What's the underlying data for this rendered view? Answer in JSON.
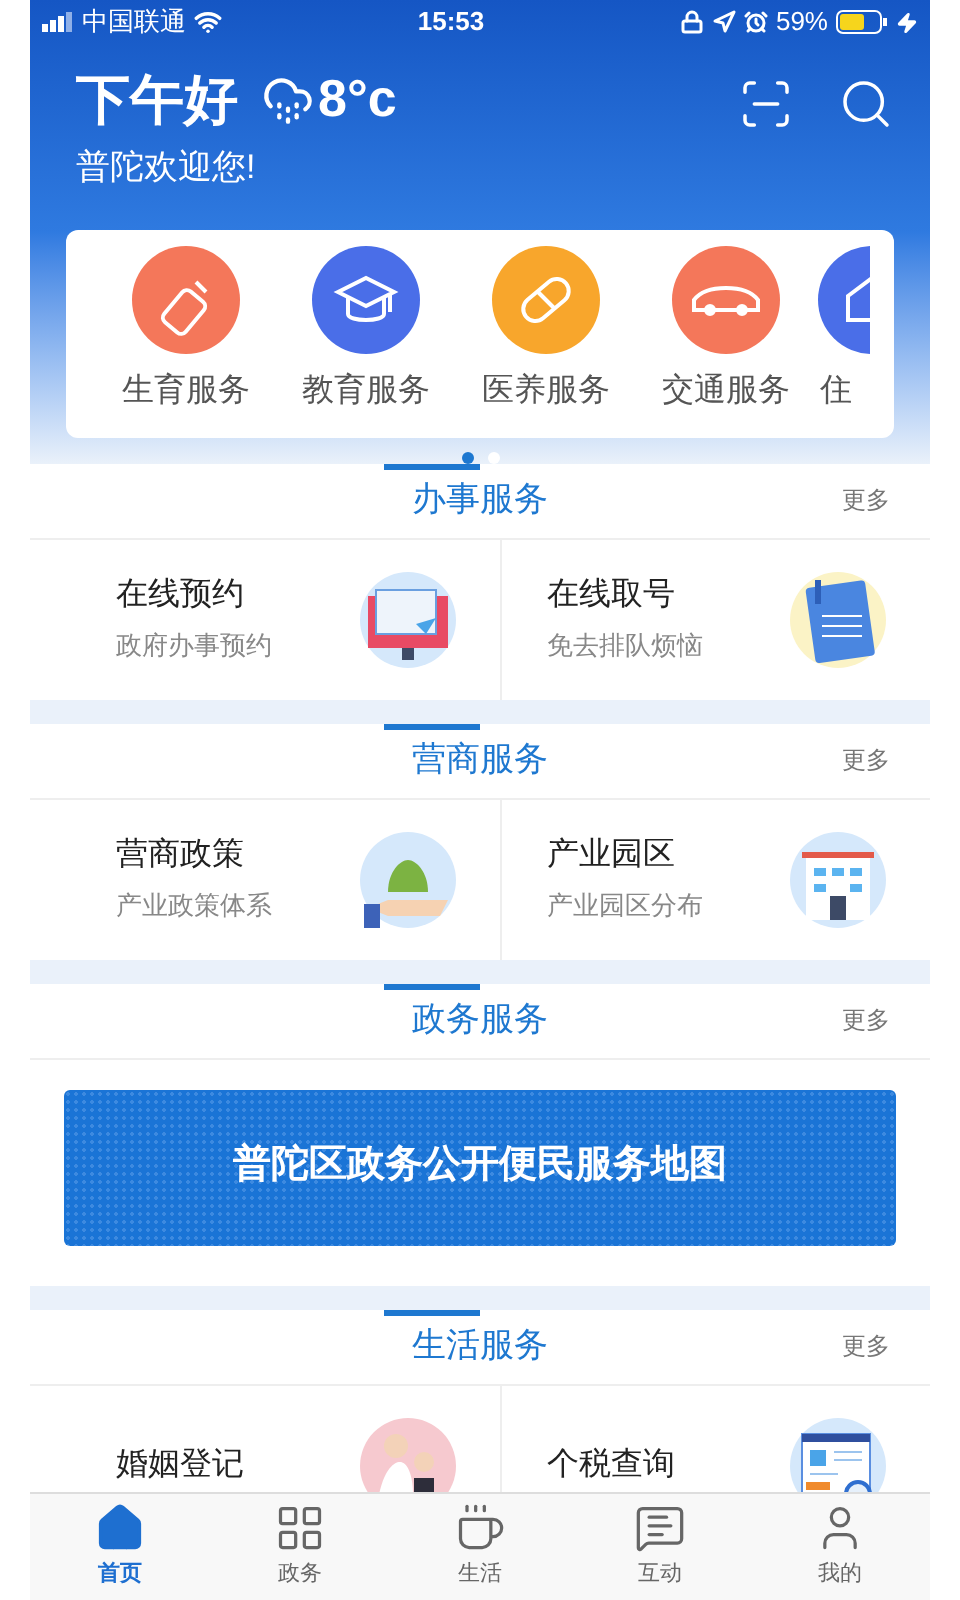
{
  "status_bar": {
    "carrier": "中国联通",
    "time": "15:53",
    "battery": "59%"
  },
  "header": {
    "greeting": "下午好",
    "temperature": "8°c",
    "welcome": "普陀欢迎您!"
  },
  "quick_services": [
    {
      "label": "生育服务",
      "kind": "bottle",
      "color": "#f4775a"
    },
    {
      "label": "教育服务",
      "kind": "cap",
      "color": "#4a6ee8"
    },
    {
      "label": "医养服务",
      "kind": "pill",
      "color": "#f8a62c"
    },
    {
      "label": "交通服务",
      "kind": "car",
      "color": "#f4775a"
    },
    {
      "label": "住",
      "kind": "clipped",
      "color": "#4a6ee8"
    }
  ],
  "carousel_dots": [
    {
      "selected": true
    },
    {
      "selected": false
    }
  ],
  "sections": [
    {
      "title": "办事服务",
      "more": "更多",
      "kind": "grid",
      "items": [
        {
          "title": "在线预约",
          "subtitle": "政府办事预约",
          "kind": "web"
        },
        {
          "title": "在线取号",
          "subtitle": "免去排队烦恼",
          "kind": "note"
        }
      ]
    },
    {
      "title": "营商服务",
      "more": "更多",
      "kind": "grid",
      "items": [
        {
          "title": "营商政策",
          "subtitle": "产业政策体系",
          "kind": "money"
        },
        {
          "title": "产业园区",
          "subtitle": "产业园区分布",
          "kind": "building"
        }
      ]
    },
    {
      "title": "政务服务",
      "more": "更多",
      "kind": "banner",
      "banner": "普陀区政务公开便民服务地图"
    },
    {
      "title": "生活服务",
      "more": "更多",
      "kind": "grid",
      "items": [
        {
          "title": "婚姻登记",
          "kind": "wedding"
        },
        {
          "title": "个税查询",
          "kind": "tax"
        }
      ]
    }
  ],
  "tab_bar": [
    {
      "label": "首页",
      "kind": "home",
      "selected": true
    },
    {
      "label": "政务",
      "kind": "grid",
      "selected": false
    },
    {
      "label": "生活",
      "kind": "cup",
      "selected": false
    },
    {
      "label": "互动",
      "kind": "chat",
      "selected": false
    },
    {
      "label": "我的",
      "kind": "user",
      "selected": false
    }
  ]
}
